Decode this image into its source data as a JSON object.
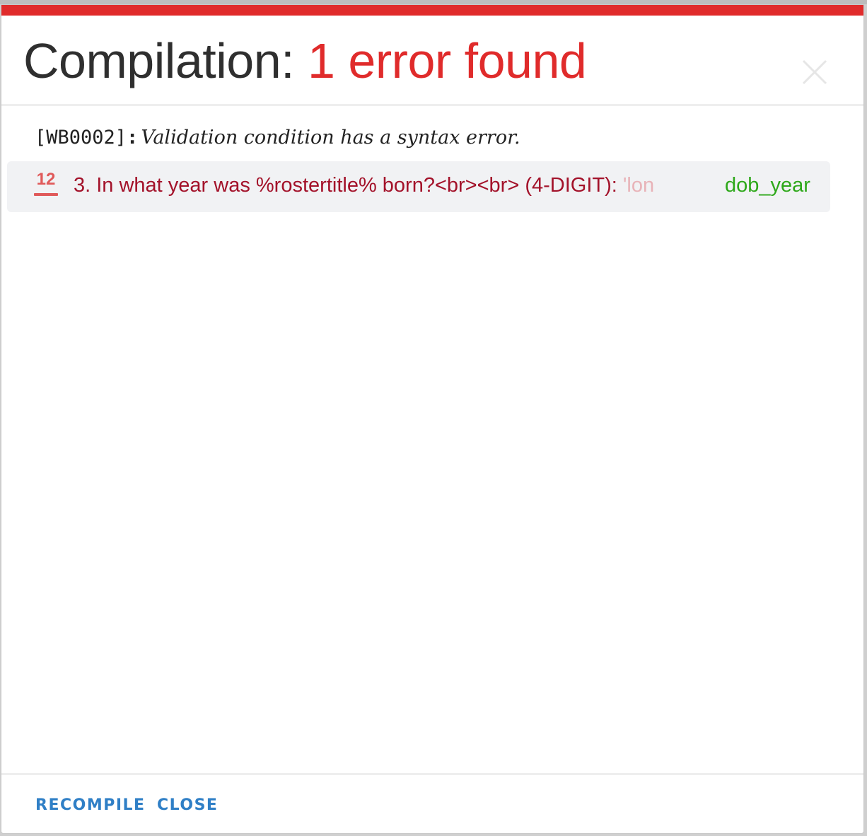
{
  "dialog": {
    "title_prefix": "Compilation:",
    "title_status": "1 error found",
    "close_icon": "close-x-icon"
  },
  "error": {
    "code": "[WB0002]",
    "separator": ":",
    "message": "Validation condition has a syntax error."
  },
  "reference": {
    "icon": "numeric-question-icon",
    "icon_label": "12",
    "question_text": "3. In what year was %rostertitle% born?<br><br> (4-DIGIT): ",
    "question_text_faded": "'lon",
    "variable": "dob_year"
  },
  "footer": {
    "recompile_label": "RECOMPILE",
    "close_label": "CLOSE"
  },
  "colors": {
    "accent_red": "#e02b2b",
    "question_red": "#a3122a",
    "variable_green": "#2ea81a",
    "link_blue": "#2f7fc6"
  }
}
